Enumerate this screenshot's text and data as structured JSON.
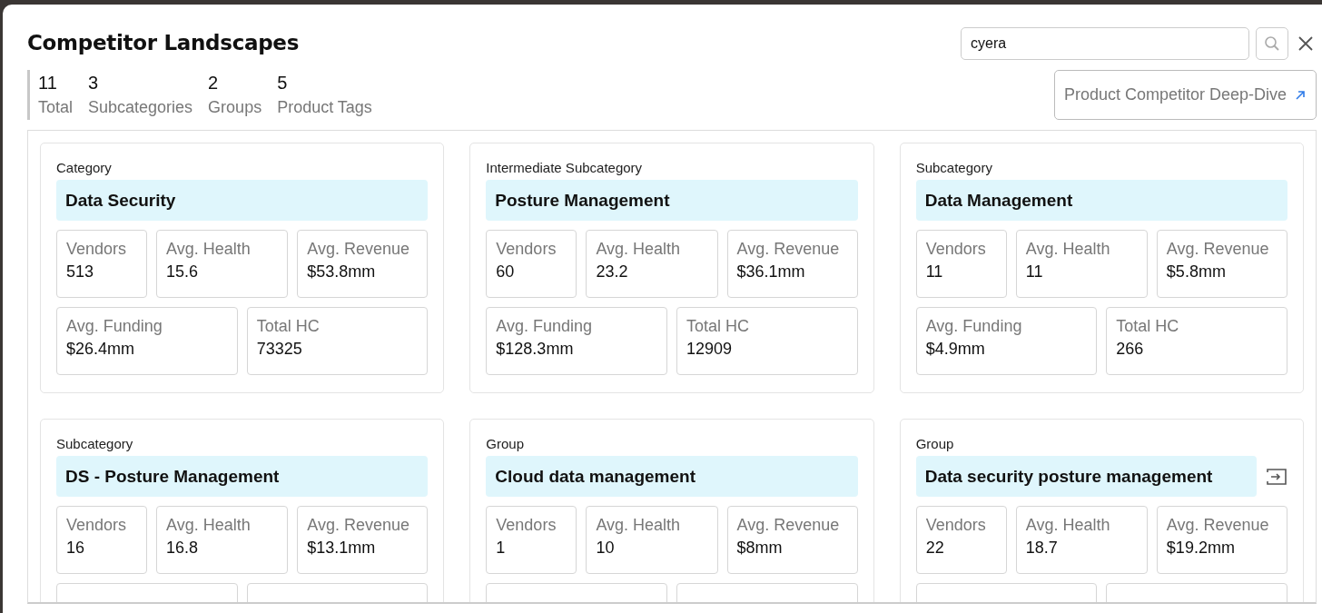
{
  "title": "Competitor Landscapes",
  "search": {
    "value": "cyera"
  },
  "summary": [
    {
      "value": "11",
      "label": "Total"
    },
    {
      "value": "3",
      "label": "Subcategories"
    },
    {
      "value": "2",
      "label": "Groups"
    },
    {
      "value": "5",
      "label": "Product Tags"
    }
  ],
  "deep_dive_button": {
    "label": "Product Competitor Deep-Dive"
  },
  "cards": [
    {
      "type": "Category",
      "name": "Data Security",
      "has_action": false,
      "clipped": false,
      "stats": [
        {
          "label": "Vendors",
          "value": "513"
        },
        {
          "label": "Avg. Health",
          "value": "15.6"
        },
        {
          "label": "Avg. Revenue",
          "value": "$53.8mm"
        },
        {
          "label": "Avg. Funding",
          "value": "$26.4mm"
        },
        {
          "label": "Total HC",
          "value": "73325"
        }
      ]
    },
    {
      "type": "Intermediate Subcategory",
      "name": "Posture Management",
      "has_action": false,
      "clipped": false,
      "stats": [
        {
          "label": "Vendors",
          "value": "60"
        },
        {
          "label": "Avg. Health",
          "value": "23.2"
        },
        {
          "label": "Avg. Revenue",
          "value": "$36.1mm"
        },
        {
          "label": "Avg. Funding",
          "value": "$128.3mm"
        },
        {
          "label": "Total HC",
          "value": "12909"
        }
      ]
    },
    {
      "type": "Subcategory",
      "name": "Data Management",
      "has_action": false,
      "clipped": false,
      "stats": [
        {
          "label": "Vendors",
          "value": "11"
        },
        {
          "label": "Avg. Health",
          "value": "11"
        },
        {
          "label": "Avg. Revenue",
          "value": "$5.8mm"
        },
        {
          "label": "Avg. Funding",
          "value": "$4.9mm"
        },
        {
          "label": "Total HC",
          "value": "266"
        }
      ]
    },
    {
      "type": "Subcategory",
      "name": "DS - Posture Management",
      "has_action": false,
      "clipped": true,
      "stats": [
        {
          "label": "Vendors",
          "value": "16"
        },
        {
          "label": "Avg. Health",
          "value": "16.8"
        },
        {
          "label": "Avg. Revenue",
          "value": "$13.1mm"
        }
      ]
    },
    {
      "type": "Group",
      "name": "Cloud data management",
      "has_action": false,
      "clipped": true,
      "stats": [
        {
          "label": "Vendors",
          "value": "1"
        },
        {
          "label": "Avg. Health",
          "value": "10"
        },
        {
          "label": "Avg. Revenue",
          "value": "$8mm"
        }
      ]
    },
    {
      "type": "Group",
      "name": "Data security posture management",
      "has_action": true,
      "clipped": true,
      "stats": [
        {
          "label": "Vendors",
          "value": "22"
        },
        {
          "label": "Avg. Health",
          "value": "18.7"
        },
        {
          "label": "Avg. Revenue",
          "value": "$19.2mm"
        }
      ]
    }
  ]
}
